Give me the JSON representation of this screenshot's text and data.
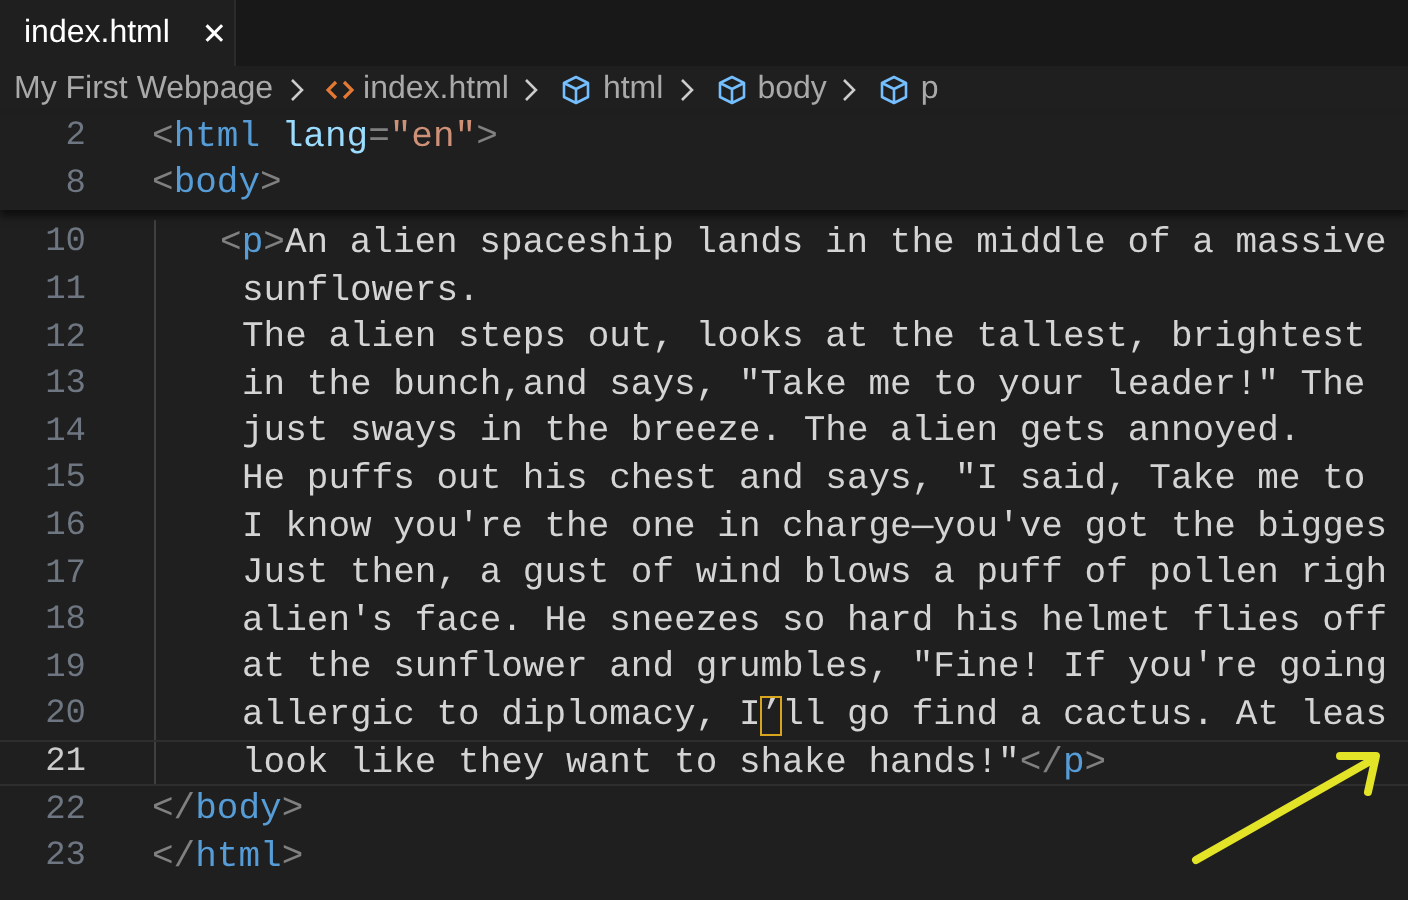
{
  "tab": {
    "label": "index.html",
    "close": "✕"
  },
  "breadcrumbs": [
    {
      "label": "My First Webpage",
      "kind": "folder"
    },
    {
      "label": "index.html",
      "kind": "file"
    },
    {
      "label": "html",
      "kind": "element"
    },
    {
      "label": "body",
      "kind": "element"
    },
    {
      "label": "p",
      "kind": "element"
    }
  ],
  "sticky_lines": [
    {
      "number": "2",
      "segments": [
        {
          "kind": "punct",
          "text": "<"
        },
        {
          "kind": "tag",
          "text": "html"
        },
        {
          "kind": "attr",
          "text": "lang"
        },
        {
          "kind": "punct",
          "text": "="
        },
        {
          "kind": "string",
          "text": "\"en\""
        },
        {
          "kind": "punct",
          "text": ">"
        }
      ]
    },
    {
      "number": "8",
      "segments": [
        {
          "kind": "punct",
          "text": "<"
        },
        {
          "kind": "tag",
          "text": "body"
        },
        {
          "kind": "punct",
          "text": ">"
        }
      ]
    }
  ],
  "lines": [
    {
      "number": "10",
      "kind": "paragraph-start",
      "current": false,
      "segments": [
        {
          "kind": "punct",
          "text": "<"
        },
        {
          "kind": "tag",
          "text": "p"
        },
        {
          "kind": "punct",
          "text": ">"
        },
        {
          "kind": "text",
          "text": "An alien spaceship lands in the middle of a massive"
        }
      ]
    },
    {
      "number": "11",
      "kind": "paragraph",
      "current": false,
      "segments": [
        {
          "kind": "text",
          "text": "sunflowers."
        }
      ]
    },
    {
      "number": "12",
      "kind": "paragraph",
      "current": false,
      "segments": [
        {
          "kind": "text",
          "text": "The alien steps out, looks at the tallest, brightest"
        }
      ]
    },
    {
      "number": "13",
      "kind": "paragraph",
      "current": false,
      "segments": [
        {
          "kind": "text",
          "text": "in the bunch,and says, \"Take me to your leader!\" The"
        }
      ]
    },
    {
      "number": "14",
      "kind": "paragraph",
      "current": false,
      "segments": [
        {
          "kind": "text",
          "text": "just sways in the breeze. The alien gets annoyed."
        }
      ]
    },
    {
      "number": "15",
      "kind": "paragraph",
      "current": false,
      "segments": [
        {
          "kind": "text",
          "text": "He puffs out his chest and says, \"I said, Take me to"
        }
      ]
    },
    {
      "number": "16",
      "kind": "paragraph",
      "current": false,
      "segments": [
        {
          "kind": "text",
          "text": "I know you're the one in charge—you've got the bigges"
        }
      ]
    },
    {
      "number": "17",
      "kind": "paragraph",
      "current": false,
      "segments": [
        {
          "kind": "text",
          "text": "Just then, a gust of wind blows a puff of pollen righ"
        }
      ]
    },
    {
      "number": "18",
      "kind": "paragraph",
      "current": false,
      "segments": [
        {
          "kind": "text",
          "text": "alien's face. He sneezes so hard his helmet flies off"
        }
      ]
    },
    {
      "number": "19",
      "kind": "paragraph",
      "current": false,
      "segments": [
        {
          "kind": "text",
          "text": "at the sunflower and grumbles, \"Fine! If you're going"
        }
      ]
    },
    {
      "number": "20",
      "kind": "paragraph",
      "current": false,
      "segments": [
        {
          "kind": "text",
          "text": "allergic to diplomacy, I"
        },
        {
          "kind": "ambiguous",
          "text": "’"
        },
        {
          "kind": "text",
          "text": "ll go find a cactus. At leas"
        }
      ]
    },
    {
      "number": "21",
      "kind": "paragraph",
      "current": true,
      "segments": [
        {
          "kind": "text",
          "text": "look like they want to shake hands!\""
        },
        {
          "kind": "punct",
          "text": "</"
        },
        {
          "kind": "tag",
          "text": "p"
        },
        {
          "kind": "punct",
          "text": ">"
        }
      ]
    },
    {
      "number": "22",
      "kind": "markup",
      "current": false,
      "segments": [
        {
          "kind": "punct",
          "text": "</"
        },
        {
          "kind": "tag",
          "text": "body"
        },
        {
          "kind": "punct",
          "text": ">"
        }
      ]
    },
    {
      "number": "23",
      "kind": "markup",
      "current": false,
      "segments": [
        {
          "kind": "punct",
          "text": "</"
        },
        {
          "kind": "tag",
          "text": "html"
        },
        {
          "kind": "punct",
          "text": ">"
        }
      ]
    }
  ]
}
